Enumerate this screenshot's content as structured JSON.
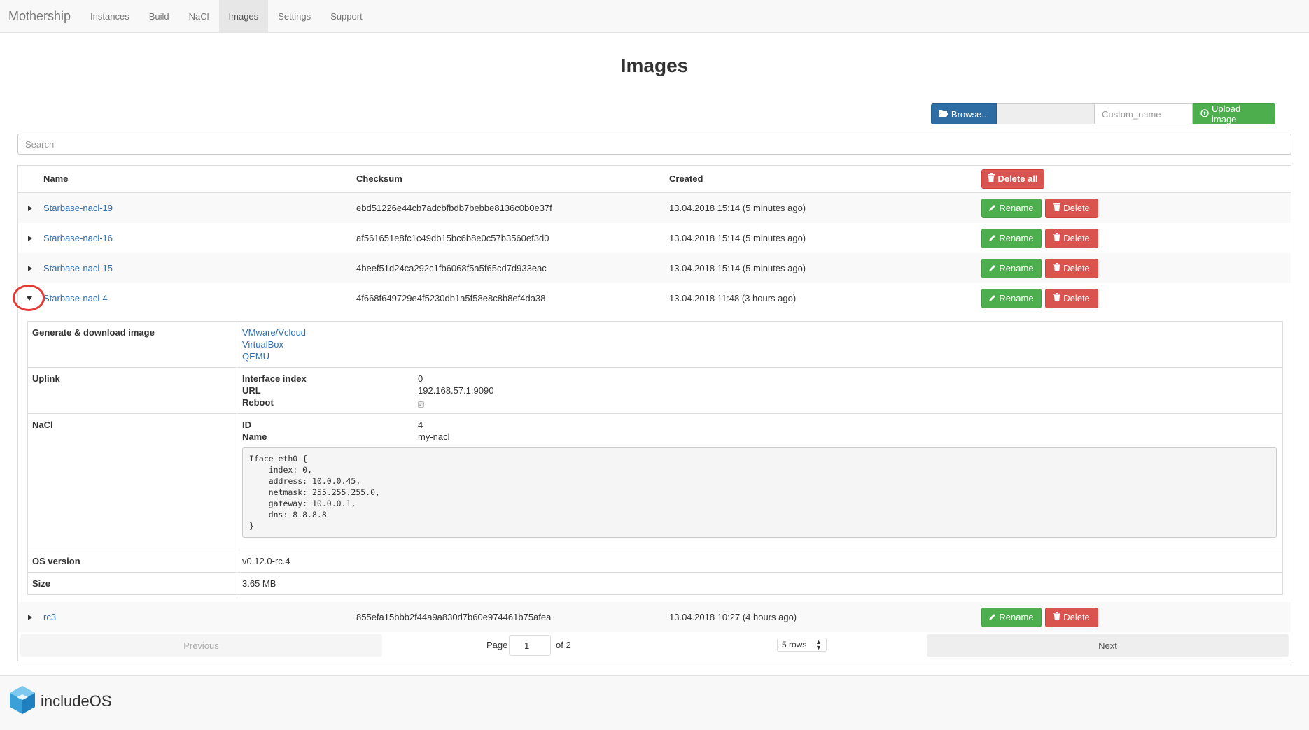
{
  "nav": {
    "brand": "Mothership",
    "items": [
      "Instances",
      "Build",
      "NaCl",
      "Images",
      "Settings",
      "Support"
    ],
    "active": "Images"
  },
  "page": {
    "title": "Images"
  },
  "upload": {
    "browse_label": "Browse...",
    "custom_name_placeholder": "Custom_name",
    "upload_label": "Upload image"
  },
  "search": {
    "placeholder": "Search"
  },
  "table": {
    "headers": {
      "name": "Name",
      "checksum": "Checksum",
      "created": "Created"
    },
    "delete_all_label": "Delete all",
    "rename_label": "Rename",
    "delete_label": "Delete",
    "rows": [
      {
        "name": "Starbase-nacl-19",
        "checksum": "ebd51226e44cb7adcbfbdb7bebbe8136c0b0e37f",
        "created": "13.04.2018 15:14 (5 minutes ago)"
      },
      {
        "name": "Starbase-nacl-16",
        "checksum": "af561651e8fc1c49db15bc6b8e0c57b3560ef3d0",
        "created": "13.04.2018 15:14 (5 minutes ago)"
      },
      {
        "name": "Starbase-nacl-15",
        "checksum": "4beef51d24ca292c1fb6068f5a5f65cd7d933eac",
        "created": "13.04.2018 15:14 (5 minutes ago)"
      },
      {
        "name": "Starbase-nacl-4",
        "checksum": "4f668f649729e4f5230db1a5f58e8c8b8ef4da38",
        "created": "13.04.2018 11:48 (3 hours ago)"
      },
      {
        "name": "rc3",
        "checksum": "855efa15bbb2f44a9a830d7b60e974461b75afea",
        "created": "13.04.2018 10:27 (4 hours ago)"
      }
    ]
  },
  "detail": {
    "generate_label": "Generate & download image",
    "download_links": [
      "VMware/Vcloud",
      "VirtualBox",
      "QEMU"
    ],
    "uplink_label": "Uplink",
    "uplink": {
      "interface_index_label": "Interface index",
      "interface_index": "0",
      "url_label": "URL",
      "url": "192.168.57.1:9090",
      "reboot_label": "Reboot",
      "reboot_checked": true
    },
    "nacl_label": "NaCl",
    "nacl": {
      "id_label": "ID",
      "id": "4",
      "name_label": "Name",
      "name": "my-nacl",
      "code": "Iface eth0 {\n    index: 0,\n    address: 10.0.0.45,\n    netmask: 255.255.255.0,\n    gateway: 10.0.0.1,\n    dns: 8.8.8.8\n}"
    },
    "os_version_label": "OS version",
    "os_version": "v0.12.0-rc.4",
    "size_label": "Size",
    "size": "3.65 MB"
  },
  "pagination": {
    "previous": "Previous",
    "page_label": "Page",
    "page_value": "1",
    "of_label": "of 2",
    "rows_option": "5 rows",
    "next": "Next"
  },
  "footer": {
    "logo_text_a": "include",
    "logo_text_b": "OS"
  },
  "colors": {
    "primary": "#2e6da4",
    "success": "#4cae4c",
    "danger": "#d9534f",
    "highlight_circle": "#e53935",
    "link": "#2f6fb3"
  }
}
